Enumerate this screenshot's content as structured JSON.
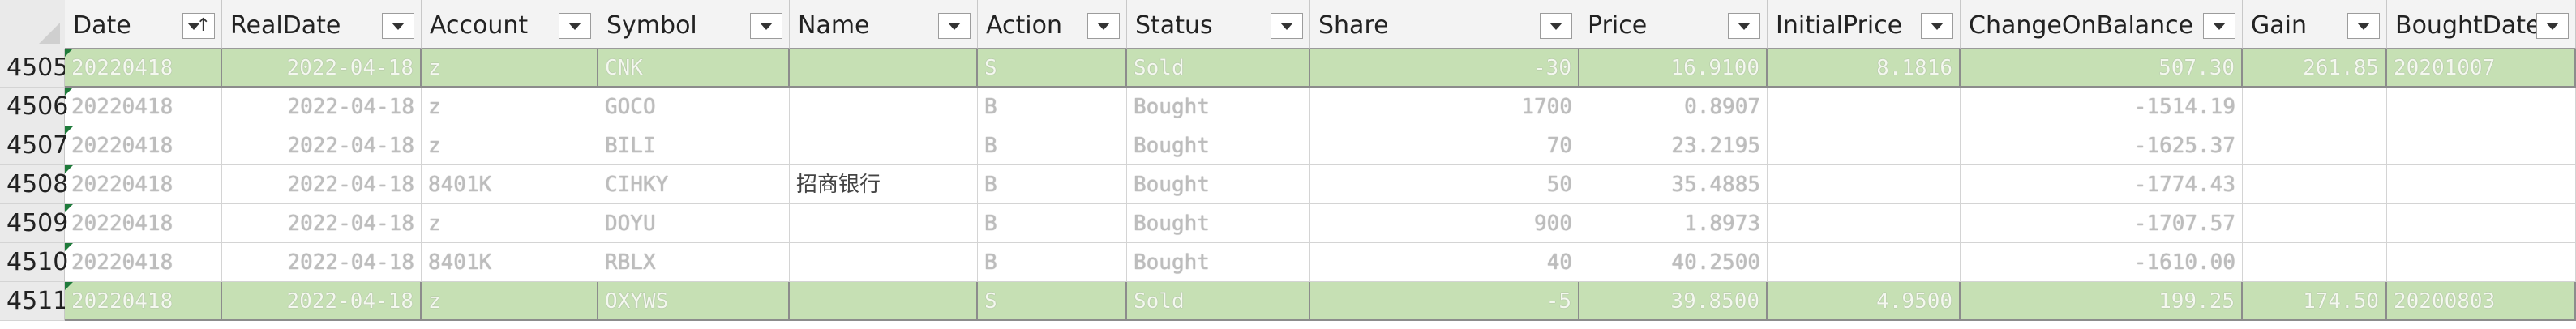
{
  "columns": [
    {
      "key": "date",
      "label": "Date",
      "align": "l",
      "sorted": true
    },
    {
      "key": "realdate",
      "label": "RealDate",
      "align": "r"
    },
    {
      "key": "account",
      "label": "Account",
      "align": "l"
    },
    {
      "key": "symbol",
      "label": "Symbol",
      "align": "l"
    },
    {
      "key": "name",
      "label": "Name",
      "align": "l"
    },
    {
      "key": "action",
      "label": "Action",
      "align": "l"
    },
    {
      "key": "status",
      "label": "Status",
      "align": "l"
    },
    {
      "key": "share",
      "label": "Share",
      "align": "r"
    },
    {
      "key": "price",
      "label": "Price",
      "align": "r"
    },
    {
      "key": "initialprice",
      "label": "InitialPrice",
      "align": "r"
    },
    {
      "key": "changeonbalance",
      "label": "ChangeOnBalance",
      "align": "r"
    },
    {
      "key": "gain",
      "label": "Gain",
      "align": "r"
    },
    {
      "key": "boughtdate",
      "label": "BoughtDate",
      "align": "l"
    }
  ],
  "rows": [
    {
      "num": "4505",
      "highlight": true,
      "cells": [
        "20220418",
        "2022-04-18",
        "z",
        "CNK",
        "",
        "S",
        "Sold",
        "-30",
        "16.9100",
        "8.1816",
        "507.30",
        "261.85",
        "20201007"
      ]
    },
    {
      "num": "4506",
      "highlight": false,
      "cells": [
        "20220418",
        "2022-04-18",
        "z",
        "GOCO",
        "",
        "B",
        "Bought",
        "1700",
        "0.8907",
        "",
        "-1514.19",
        "",
        ""
      ]
    },
    {
      "num": "4507",
      "highlight": false,
      "cells": [
        "20220418",
        "2022-04-18",
        "z",
        "BILI",
        "",
        "B",
        "Bought",
        "70",
        "23.2195",
        "",
        "-1625.37",
        "",
        ""
      ]
    },
    {
      "num": "4508",
      "highlight": false,
      "cells": [
        "20220418",
        "2022-04-18",
        "8401K",
        "CIHKY",
        "招商银行",
        "B",
        "Bought",
        "50",
        "35.4885",
        "",
        "-1774.43",
        "",
        ""
      ]
    },
    {
      "num": "4509",
      "highlight": false,
      "cells": [
        "20220418",
        "2022-04-18",
        "z",
        "DOYU",
        "",
        "B",
        "Bought",
        "900",
        "1.8973",
        "",
        "-1707.57",
        "",
        ""
      ]
    },
    {
      "num": "4510",
      "highlight": false,
      "cells": [
        "20220418",
        "2022-04-18",
        "8401K",
        "RBLX",
        "",
        "B",
        "Bought",
        "40",
        "40.2500",
        "",
        "-1610.00",
        "",
        ""
      ]
    },
    {
      "num": "4511",
      "highlight": true,
      "cells": [
        "20220418",
        "2022-04-18",
        "z",
        "OXYWS",
        "",
        "S",
        "Sold",
        "-5",
        "39.8500",
        "4.9500",
        "199.25",
        "174.50",
        "20200803"
      ]
    }
  ],
  "colors": {
    "highlight": "#c6e0b4",
    "header_bg": "#f3f3f3",
    "grid": "#d4d4d4",
    "green_marker": "#1e7a3a"
  }
}
